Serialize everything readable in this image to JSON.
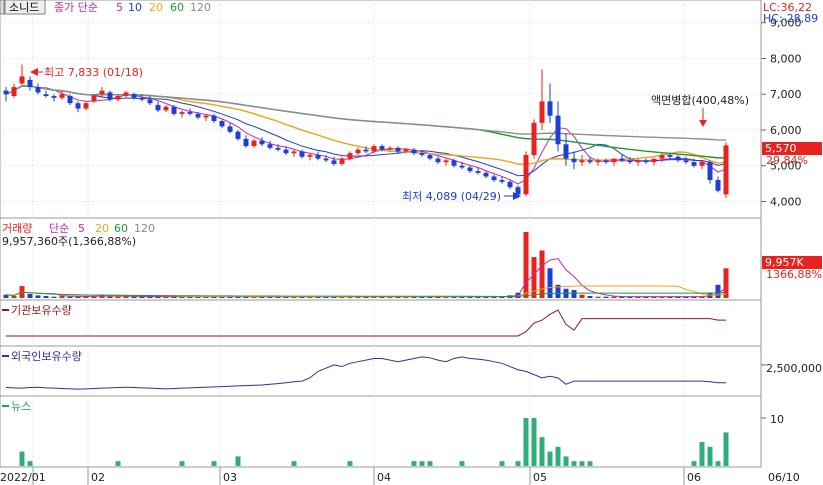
{
  "header": {
    "stock_name": "소니드",
    "price_type_label": "종가 단순",
    "ma_periods": [
      "5",
      "10",
      "20",
      "60",
      "120"
    ],
    "lc_text": "LC:36,22",
    "hc_text": "HC:-28,89"
  },
  "price_panel": {
    "y_ticks": [
      "9,000",
      "8,000",
      "7,000",
      "6,000",
      "5,000",
      "4,000"
    ],
    "y_tick_values": [
      9000,
      8000,
      7000,
      6000,
      5000,
      4000
    ],
    "ylim": [
      3650,
      9300
    ],
    "current_price_label": "5,570",
    "current_change_label": "29,84%",
    "high_annotation": "최고 7,833 (01/18)",
    "low_annotation": "최저 4,089 (04/29)",
    "event_annotation": "액면병합(400,48%)",
    "colors": {
      "up": "#e8231f",
      "down": "#1d3fd6",
      "ma5": "#c42aa6",
      "ma10": "#1d3fd6",
      "ma20": "#f0a21c",
      "ma60": "#1f9a2f",
      "ma120": "#8c8c8c"
    }
  },
  "volume_panel": {
    "title": "거래량",
    "ma_label": "단순",
    "ma_periods": [
      "5",
      "20",
      "60",
      "120"
    ],
    "summary": "9,957,360주(1,366,88%)",
    "value_label": "9,957K",
    "pct_label": "1366,88%"
  },
  "institution_panel": {
    "title": "기관보유수량"
  },
  "foreign_panel": {
    "title": "외국인보유수량",
    "y_tick": "2,500,000"
  },
  "news_panel": {
    "title": "뉴스",
    "y_tick": "10"
  },
  "x_axis": {
    "labels": [
      "2022/01",
      "02",
      "03",
      "04",
      "05",
      "06",
      "06/10"
    ]
  },
  "chart_data": {
    "type": "candlestick",
    "ma_periods": [
      5,
      10,
      20,
      60,
      120
    ],
    "annotations": {
      "high": {
        "value": 7833,
        "date": "01/18"
      },
      "low": {
        "value": 4089,
        "date": "04/29"
      },
      "event": "액면병합(400,48%)"
    },
    "candles": [
      [
        7100,
        7200,
        6800,
        7000
      ],
      [
        6950,
        7300,
        6900,
        7200
      ],
      [
        7300,
        7833,
        7250,
        7500
      ],
      [
        7400,
        7500,
        7100,
        7200
      ],
      [
        7200,
        7300,
        7000,
        7050
      ],
      [
        7000,
        7100,
        6900,
        6950
      ],
      [
        6950,
        7000,
        6800,
        6900
      ],
      [
        6900,
        7100,
        6850,
        7000
      ],
      [
        6950,
        7000,
        6700,
        6750
      ],
      [
        6750,
        6800,
        6500,
        6600
      ],
      [
        6600,
        6800,
        6550,
        6750
      ],
      [
        6800,
        7000,
        6750,
        6950
      ],
      [
        7000,
        7200,
        6900,
        7100
      ],
      [
        7050,
        7100,
        6800,
        6850
      ],
      [
        6850,
        7000,
        6800,
        6950
      ],
      [
        6950,
        7100,
        6900,
        7050
      ],
      [
        7000,
        7050,
        6850,
        6900
      ],
      [
        6900,
        7000,
        6800,
        6850
      ],
      [
        6850,
        6950,
        6700,
        6750
      ],
      [
        6700,
        6800,
        6500,
        6550
      ],
      [
        6550,
        6700,
        6500,
        6650
      ],
      [
        6650,
        6700,
        6400,
        6450
      ],
      [
        6450,
        6550,
        6350,
        6500
      ],
      [
        6500,
        6600,
        6400,
        6450
      ],
      [
        6450,
        6500,
        6300,
        6350
      ],
      [
        6350,
        6450,
        6250,
        6400
      ],
      [
        6400,
        6450,
        6200,
        6250
      ],
      [
        6250,
        6300,
        6050,
        6100
      ],
      [
        6100,
        6200,
        5900,
        5950
      ],
      [
        5950,
        6000,
        5700,
        5750
      ],
      [
        5750,
        5850,
        5500,
        5550
      ],
      [
        5550,
        5750,
        5500,
        5700
      ],
      [
        5700,
        5800,
        5550,
        5600
      ],
      [
        5600,
        5700,
        5450,
        5500
      ],
      [
        5500,
        5600,
        5400,
        5450
      ],
      [
        5450,
        5550,
        5300,
        5350
      ],
      [
        5350,
        5450,
        5250,
        5400
      ],
      [
        5400,
        5450,
        5200,
        5250
      ],
      [
        5250,
        5350,
        5150,
        5300
      ],
      [
        5300,
        5400,
        5150,
        5200
      ],
      [
        5200,
        5300,
        5100,
        5150
      ],
      [
        5150,
        5250,
        5000,
        5050
      ],
      [
        5050,
        5250,
        5000,
        5200
      ],
      [
        5200,
        5400,
        5150,
        5350
      ],
      [
        5350,
        5500,
        5300,
        5450
      ],
      [
        5450,
        5550,
        5350,
        5400
      ],
      [
        5400,
        5600,
        5350,
        5550
      ],
      [
        5550,
        5600,
        5400,
        5450
      ],
      [
        5450,
        5550,
        5400,
        5500
      ],
      [
        5500,
        5550,
        5350,
        5400
      ],
      [
        5400,
        5500,
        5350,
        5450
      ],
      [
        5450,
        5500,
        5300,
        5350
      ],
      [
        5350,
        5400,
        5250,
        5300
      ],
      [
        5300,
        5350,
        5150,
        5200
      ],
      [
        5200,
        5250,
        5050,
        5100
      ],
      [
        5100,
        5200,
        5000,
        5150
      ],
      [
        5150,
        5200,
        4950,
        5000
      ],
      [
        5000,
        5100,
        4900,
        4950
      ],
      [
        4950,
        5000,
        4800,
        4850
      ],
      [
        4850,
        4950,
        4750,
        4800
      ],
      [
        4800,
        4850,
        4650,
        4700
      ],
      [
        4700,
        4750,
        4550,
        4600
      ],
      [
        4600,
        4700,
        4500,
        4550
      ],
      [
        4550,
        4600,
        4350,
        4400
      ],
      [
        4400,
        4450,
        4089,
        4200
      ],
      [
        4200,
        5400,
        4150,
        5300
      ],
      [
        5300,
        6300,
        5200,
        6200
      ],
      [
        6200,
        7700,
        6000,
        6800
      ],
      [
        6800,
        7300,
        6200,
        6400
      ],
      [
        6400,
        6800,
        5400,
        5600
      ],
      [
        5600,
        5900,
        5000,
        5200
      ],
      [
        5200,
        5400,
        4900,
        5100
      ],
      [
        5100,
        5300,
        5000,
        5150
      ],
      [
        5150,
        5250,
        5050,
        5100
      ],
      [
        5100,
        5200,
        5000,
        5150
      ],
      [
        5150,
        5200,
        5050,
        5100
      ],
      [
        5100,
        5200,
        5000,
        5200
      ],
      [
        5200,
        5300,
        5100,
        5150
      ],
      [
        5150,
        5250,
        5050,
        5100
      ],
      [
        5100,
        5200,
        5000,
        5150
      ],
      [
        5150,
        5200,
        5050,
        5100
      ],
      [
        5100,
        5200,
        5000,
        5200
      ],
      [
        5200,
        5350,
        5100,
        5300
      ],
      [
        5300,
        5350,
        5150,
        5250
      ],
      [
        5250,
        5300,
        5100,
        5150
      ],
      [
        5150,
        5250,
        5050,
        5100
      ],
      [
        5100,
        5200,
        4950,
        5000
      ],
      [
        5000,
        5150,
        4900,
        5100
      ],
      [
        5100,
        5150,
        4500,
        4600
      ],
      [
        4600,
        4700,
        4250,
        4300
      ],
      [
        4200,
        5650,
        4100,
        5570
      ]
    ],
    "volume_pct": [
      5,
      3,
      18,
      6,
      4,
      3,
      2,
      3,
      2,
      2,
      3,
      3,
      4,
      2,
      2,
      3,
      2,
      2,
      2,
      2,
      2,
      2,
      2,
      2,
      2,
      2,
      2,
      2,
      2,
      2,
      2,
      2,
      2,
      2,
      2,
      2,
      2,
      2,
      2,
      2,
      2,
      2,
      2,
      2,
      2,
      2,
      2,
      2,
      2,
      2,
      2,
      2,
      2,
      2,
      2,
      2,
      2,
      2,
      2,
      2,
      2,
      2,
      3,
      4,
      8,
      100,
      62,
      72,
      45,
      20,
      14,
      12,
      5,
      3,
      2,
      2,
      2,
      2,
      2,
      2,
      2,
      2,
      2,
      2,
      2,
      2,
      2,
      2,
      8,
      20,
      45
    ],
    "news_counts": [
      0,
      0,
      3,
      1,
      0,
      0,
      0,
      0,
      0,
      0,
      0,
      0,
      0,
      0,
      1,
      0,
      0,
      0,
      0,
      0,
      0,
      0,
      1,
      0,
      0,
      0,
      1,
      0,
      0,
      2,
      0,
      0,
      0,
      0,
      0,
      0,
      1,
      0,
      0,
      0,
      0,
      0,
      0,
      1,
      0,
      0,
      0,
      0,
      0,
      0,
      0,
      1,
      1,
      1,
      0,
      0,
      0,
      1,
      0,
      0,
      0,
      0,
      1,
      0,
      1,
      10,
      10,
      6,
      3,
      4,
      2,
      1,
      1,
      1,
      0,
      0,
      0,
      0,
      0,
      0,
      0,
      0,
      0,
      0,
      0,
      0,
      1,
      5,
      4,
      1,
      7
    ],
    "foreign_holding": [
      1800000,
      1790000,
      1780000,
      1800000,
      1810000,
      1790000,
      1780000,
      1770000,
      1760000,
      1750000,
      1760000,
      1770000,
      1780000,
      1790000,
      1800000,
      1810000,
      1800000,
      1790000,
      1780000,
      1770000,
      1760000,
      1770000,
      1780000,
      1790000,
      1800000,
      1810000,
      1820000,
      1830000,
      1840000,
      1850000,
      1860000,
      1870000,
      1880000,
      1900000,
      1920000,
      1950000,
      1980000,
      2000000,
      2100000,
      2300000,
      2400000,
      2500000,
      2450000,
      2550000,
      2600000,
      2650000,
      2700000,
      2700000,
      2650000,
      2600000,
      2650000,
      2700000,
      2750000,
      2720000,
      2650000,
      2600000,
      2700000,
      2750000,
      2700000,
      2680000,
      2650000,
      2600000,
      2550000,
      2450000,
      2350000,
      2300000,
      2200000,
      2100000,
      2150000,
      2100000,
      1900000,
      2000000,
      2000000,
      2000000,
      2000000,
      2000000,
      2000000,
      2000000,
      2000000,
      2000000,
      2000000,
      2000000,
      2000000,
      2000000,
      2000000,
      2000000,
      2000000,
      2000000,
      1980000,
      1950000,
      1950000
    ],
    "institution_holding": [
      0,
      0,
      0,
      0,
      0,
      0,
      0,
      0,
      0,
      0,
      0,
      0,
      0,
      0,
      0,
      0,
      0,
      0,
      0,
      0,
      0,
      0,
      0,
      0,
      0,
      0,
      0,
      0,
      0,
      0,
      0,
      0,
      0,
      0,
      0,
      0,
      0,
      0,
      0,
      0,
      0,
      0,
      0,
      0,
      0,
      0,
      0,
      0,
      0,
      0,
      0,
      0,
      0,
      0,
      0,
      0,
      0,
      0,
      0,
      0,
      0,
      0,
      0,
      0,
      0,
      3,
      9,
      11,
      15,
      18,
      8,
      4,
      12,
      12,
      12,
      12,
      12,
      12,
      12,
      12,
      12,
      12,
      12,
      12,
      12,
      12,
      12,
      12,
      12,
      11,
      11
    ]
  }
}
